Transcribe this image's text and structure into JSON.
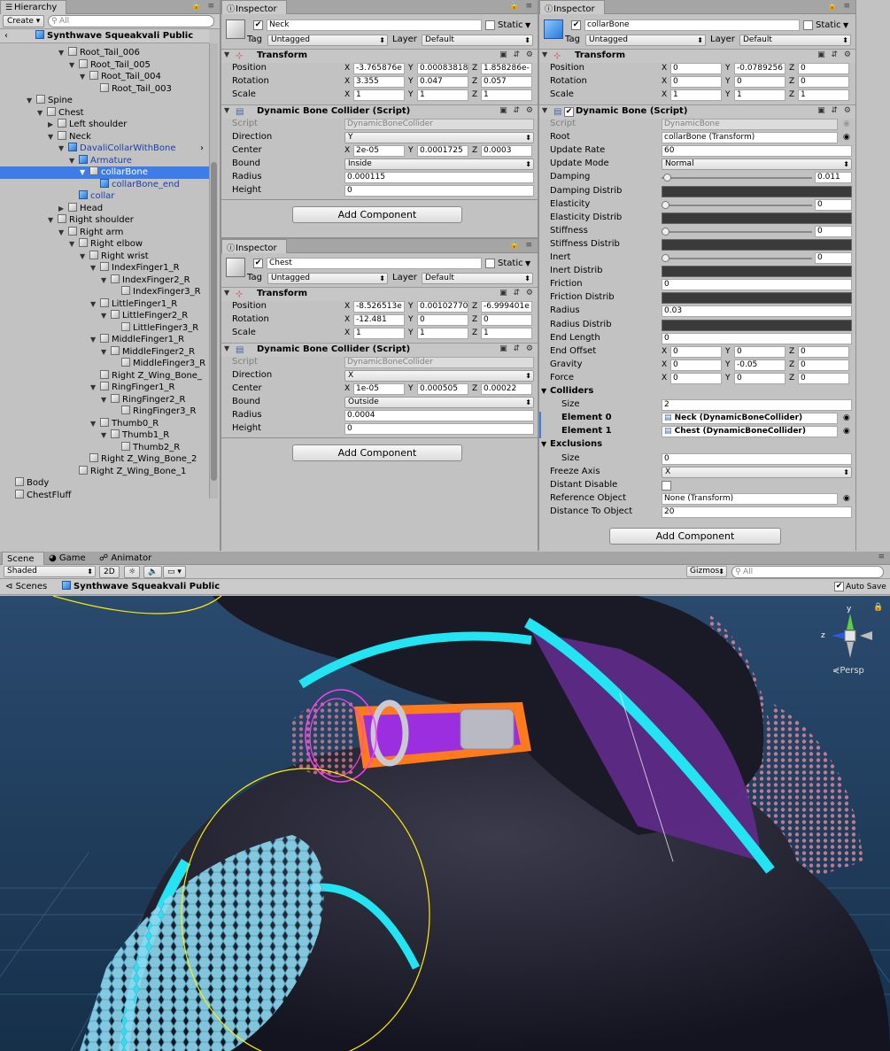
{
  "colors": {
    "accent": "#3e7de7",
    "cyan": "#22e4f2",
    "purple": "#9b2fe0",
    "orange": "#ff7a1a",
    "skin": "#2a2a3a",
    "sky": "#1e3a57"
  },
  "hierarchy": {
    "tab": "Hierarchy",
    "create": "Create",
    "search_placeholder": "All",
    "scene": "Synthwave Squeakvali Public",
    "items": [
      {
        "label": "Root_Tail_006",
        "d": 6,
        "tri": "open"
      },
      {
        "label": "Root_Tail_005",
        "d": 7,
        "tri": "open"
      },
      {
        "label": "Root_Tail_004",
        "d": 8,
        "tri": "open"
      },
      {
        "label": "Root_Tail_003",
        "d": 9,
        "tri": ""
      },
      {
        "label": "Spine",
        "d": 3,
        "tri": "open"
      },
      {
        "label": "Chest",
        "d": 4,
        "tri": "open"
      },
      {
        "label": "Left shoulder",
        "d": 5,
        "tri": "closed"
      },
      {
        "label": "Neck",
        "d": 5,
        "tri": "open"
      },
      {
        "label": "DavaliCollarWithBone",
        "d": 6,
        "tri": "open",
        "blue": true,
        "prefab": true
      },
      {
        "label": "Armature",
        "d": 7,
        "tri": "open",
        "blue": true
      },
      {
        "label": "collarBone",
        "d": 8,
        "tri": "open",
        "selected": true
      },
      {
        "label": "collarBone_end",
        "d": 9,
        "tri": "",
        "blue": true
      },
      {
        "label": "collar",
        "d": 7,
        "tri": "",
        "blue": true
      },
      {
        "label": "Head",
        "d": 6,
        "tri": "closed"
      },
      {
        "label": "Right shoulder",
        "d": 5,
        "tri": "open"
      },
      {
        "label": "Right arm",
        "d": 6,
        "tri": "open"
      },
      {
        "label": "Right elbow",
        "d": 7,
        "tri": "open"
      },
      {
        "label": "Right wrist",
        "d": 8,
        "tri": "open"
      },
      {
        "label": "IndexFinger1_R",
        "d": 9,
        "tri": "open"
      },
      {
        "label": "IndexFinger2_R",
        "d": 10,
        "tri": "open"
      },
      {
        "label": "IndexFinger3_R",
        "d": 11,
        "tri": ""
      },
      {
        "label": "LittleFinger1_R",
        "d": 9,
        "tri": "open"
      },
      {
        "label": "LittleFinger2_R",
        "d": 10,
        "tri": "open"
      },
      {
        "label": "LittleFinger3_R",
        "d": 11,
        "tri": ""
      },
      {
        "label": "MiddleFinger1_R",
        "d": 9,
        "tri": "open"
      },
      {
        "label": "MiddleFinger2_R",
        "d": 10,
        "tri": "open"
      },
      {
        "label": "MiddleFinger3_R",
        "d": 11,
        "tri": ""
      },
      {
        "label": "Right Z_Wing_Bone_",
        "d": 9,
        "tri": ""
      },
      {
        "label": "RingFinger1_R",
        "d": 9,
        "tri": "open"
      },
      {
        "label": "RingFinger2_R",
        "d": 10,
        "tri": "open"
      },
      {
        "label": "RingFinger3_R",
        "d": 11,
        "tri": ""
      },
      {
        "label": "Thumb0_R",
        "d": 9,
        "tri": "open"
      },
      {
        "label": "Thumb1_R",
        "d": 10,
        "tri": "open"
      },
      {
        "label": "Thumb2_R",
        "d": 11,
        "tri": ""
      },
      {
        "label": "Right Z_Wing_Bone_2",
        "d": 8,
        "tri": ""
      },
      {
        "label": "Right Z_Wing_Bone_1",
        "d": 7,
        "tri": ""
      },
      {
        "label": "Body",
        "d": 1,
        "tri": ""
      },
      {
        "label": "ChestFluff",
        "d": 1,
        "tri": ""
      }
    ]
  },
  "common": {
    "tag": "Tag",
    "layer": "Layer",
    "untagged": "Untagged",
    "default_layer": "Default",
    "static": "Static",
    "add_component": "Add Component",
    "transform": "Transform",
    "position": "Position",
    "rotation": "Rotation",
    "scale": "Scale",
    "x": "X",
    "y": "Y",
    "z": "Z",
    "script": "Script"
  },
  "insp_neck": {
    "tab": "Inspector",
    "name": "Neck",
    "pos": [
      "-3.765876e",
      "0.00083818",
      "1.858286e-"
    ],
    "rot": [
      "3.355",
      "0.047",
      "0.057"
    ],
    "scl": [
      "1",
      "1",
      "1"
    ],
    "comp": "Dynamic Bone Collider (Script)",
    "script": "DynamicBoneCollider",
    "dir_lbl": "Direction",
    "dir": "Y",
    "center_lbl": "Center",
    "center": [
      "2e-05",
      "0.0001725",
      "0.0003"
    ],
    "bound_lbl": "Bound",
    "bound": "Inside",
    "radius_lbl": "Radius",
    "radius": "0.000115",
    "height_lbl": "Height",
    "height": "0"
  },
  "insp_chest": {
    "tab": "Inspector",
    "name": "Chest",
    "pos": [
      "-8.526513e",
      "0.00102770",
      "-6.999401e"
    ],
    "rot": [
      "-12.481",
      "0",
      "0"
    ],
    "scl": [
      "1",
      "1",
      "1"
    ],
    "comp": "Dynamic Bone Collider (Script)",
    "script": "DynamicBoneCollider",
    "dir": "X",
    "center": [
      "1e-05",
      "0.000505",
      "0.00022"
    ],
    "bound": "Outside",
    "radius": "0.0004",
    "height": "0"
  },
  "insp_bone": {
    "tab": "Inspector",
    "name": "collarBone",
    "pos": [
      "0",
      "-0.0789256",
      "0"
    ],
    "rot": [
      "0",
      "0",
      "0"
    ],
    "scl": [
      "1",
      "1",
      "1"
    ],
    "comp": "Dynamic Bone (Script)",
    "script": "DynamicBone",
    "root_lbl": "Root",
    "root": "collarBone (Transform)",
    "update_rate_lbl": "Update Rate",
    "update_rate": "60",
    "update_mode_lbl": "Update Mode",
    "update_mode": "Normal",
    "damping_lbl": "Damping",
    "damping": "0.011",
    "damping_d": "Damping Distrib",
    "elasticity_lbl": "Elasticity",
    "elasticity": "0",
    "elasticity_d": "Elasticity Distrib",
    "stiffness_lbl": "Stiffness",
    "stiffness": "0",
    "stiffness_d": "Stiffness Distrib",
    "inert_lbl": "Inert",
    "inert": "0",
    "inert_d": "Inert Distrib",
    "friction_lbl": "Friction",
    "friction": "0",
    "friction_d": "Friction Distrib",
    "radius_lbl": "Radius",
    "radius": "0.03",
    "radius_d": "Radius Distrib",
    "end_length_lbl": "End Length",
    "end_length": "0",
    "end_offset_lbl": "End Offset",
    "end_offset": [
      "0",
      "0",
      "0"
    ],
    "gravity_lbl": "Gravity",
    "gravity": [
      "0",
      "-0.05",
      "0"
    ],
    "force_lbl": "Force",
    "force": [
      "0",
      "0",
      "0"
    ],
    "colliders_lbl": "Colliders",
    "size_lbl": "Size",
    "colliders_size": "2",
    "el0_lbl": "Element 0",
    "el0": "Neck (DynamicBoneCollider)",
    "el1_lbl": "Element 1",
    "el1": "Chest (DynamicBoneCollider)",
    "exclusions_lbl": "Exclusions",
    "excl_size": "0",
    "freeze_lbl": "Freeze Axis",
    "freeze": "X",
    "distant_lbl": "Distant Disable",
    "refobj_lbl": "Reference Object",
    "refobj": "None (Transform)",
    "dist_lbl": "Distance To Object",
    "dist": "20"
  },
  "scene": {
    "tabs": [
      "Scene",
      "Game",
      "Animator"
    ],
    "shaded": "Shaded",
    "twod": "2D",
    "gizmos": "Gizmos",
    "search_placeholder": "All",
    "crumb_scenes": "Scenes",
    "crumb_scene": "Synthwave Squeakvali Public",
    "autosave": "Auto Save",
    "persp": "Persp"
  }
}
